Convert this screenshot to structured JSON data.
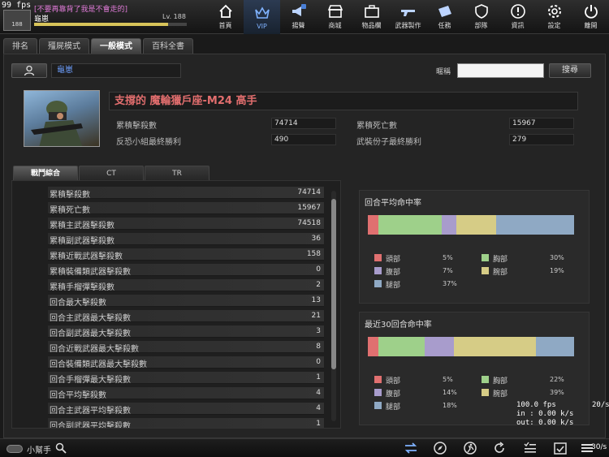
{
  "overlay": {
    "fps_corner": "99 fps",
    "fps": "100.0 fps",
    "in": "in : 0.00 k/s",
    "out": "out: 0.00 k/s",
    "rate_right": "20/s",
    "footer_num": "30/s"
  },
  "player": {
    "rank_badge": "188",
    "notice": "[不要再靠背了我是不會走的]",
    "name": "龜崽",
    "level": "Lv. 188",
    "exp_progress": 0.88
  },
  "nav": [
    {
      "label": "首頁",
      "icon": "home-icon"
    },
    {
      "label": "VIP",
      "icon": "crown-icon"
    },
    {
      "label": "揚聲",
      "icon": "megaphone-icon"
    },
    {
      "label": "商城",
      "icon": "shop-icon"
    },
    {
      "label": "物品欄",
      "icon": "briefcase-icon"
    },
    {
      "label": "武器製作",
      "icon": "gun-icon"
    },
    {
      "label": "任務",
      "icon": "ticket-icon"
    },
    {
      "label": "部隊",
      "icon": "shield-icon"
    },
    {
      "label": "資訊",
      "icon": "info-icon"
    },
    {
      "label": "設定",
      "icon": "gear-icon"
    },
    {
      "label": "離開",
      "icon": "power-icon"
    }
  ],
  "tabs": [
    "排名",
    "殭屍模式",
    "一般模式",
    "百科全書"
  ],
  "active_tab": 2,
  "search": {
    "name_value": "龜崽",
    "nickname_label": "暱稱",
    "input_value": "",
    "button_label": "搜尋"
  },
  "profile": {
    "title": "支撐的 魔輪獵戶座-M24 高手",
    "stats": [
      {
        "label": "累積擊殺數",
        "value": "74714"
      },
      {
        "label": "累積死亡數",
        "value": "15967"
      },
      {
        "label": "反恐小組最終勝利",
        "value": "490"
      },
      {
        "label": "武裝份子最終勝利",
        "value": "279"
      }
    ]
  },
  "sub_tabs": [
    "戰鬥綜合",
    "CT",
    "TR"
  ],
  "active_sub_tab": 0,
  "combat_stats": [
    {
      "label": "累積擊殺數",
      "value": "74714"
    },
    {
      "label": "累積死亡數",
      "value": "15967"
    },
    {
      "label": "累積主武器擊殺數",
      "value": "74518"
    },
    {
      "label": "累積副武器擊殺數",
      "value": "36"
    },
    {
      "label": "累積近戰武器擊殺數",
      "value": "158"
    },
    {
      "label": "累積裝備類武器擊殺數",
      "value": "0"
    },
    {
      "label": "累積手榴彈擊殺數",
      "value": "2"
    },
    {
      "label": "回合最大擊殺數",
      "value": "13"
    },
    {
      "label": "回合主武器最大擊殺數",
      "value": "21"
    },
    {
      "label": "回合副武器最大擊殺數",
      "value": "3"
    },
    {
      "label": "回合近戰武器最大擊殺數",
      "value": "8"
    },
    {
      "label": "回合裝備類武器最大擊殺數",
      "value": "0"
    },
    {
      "label": "回合手榴彈最大擊殺數",
      "value": "1"
    },
    {
      "label": "回合平均擊殺數",
      "value": "4"
    },
    {
      "label": "回合主武器平均擊殺數",
      "value": "4"
    },
    {
      "label": "回合副武器平均擊殺數",
      "value": "1"
    }
  ],
  "hit_colors": {
    "head": "#e07070",
    "chest": "#9ed08a",
    "belly": "#a89ccc",
    "arm": "#d6cc86",
    "leg": "#8fa9c4"
  },
  "hit_panels": [
    {
      "title": "回合平均命中率",
      "parts": [
        {
          "key": "head",
          "label": "頭部",
          "pct": "5%",
          "value": 5
        },
        {
          "key": "chest",
          "label": "胸部",
          "pct": "30%",
          "value": 30
        },
        {
          "key": "belly",
          "label": "腹部",
          "pct": "7%",
          "value": 7
        },
        {
          "key": "arm",
          "label": "腕部",
          "pct": "19%",
          "value": 19
        },
        {
          "key": "leg",
          "label": "腿部",
          "pct": "37%",
          "value": 37
        }
      ]
    },
    {
      "title": "最近30回合命中率",
      "parts": [
        {
          "key": "head",
          "label": "頭部",
          "pct": "5%",
          "value": 5
        },
        {
          "key": "chest",
          "label": "胸部",
          "pct": "22%",
          "value": 22
        },
        {
          "key": "belly",
          "label": "腹部",
          "pct": "14%",
          "value": 14
        },
        {
          "key": "arm",
          "label": "腕部",
          "pct": "39%",
          "value": 39
        },
        {
          "key": "leg",
          "label": "腿部",
          "pct": "18%",
          "value": 18
        }
      ]
    }
  ],
  "footer": {
    "helper_label": "小幫手"
  }
}
